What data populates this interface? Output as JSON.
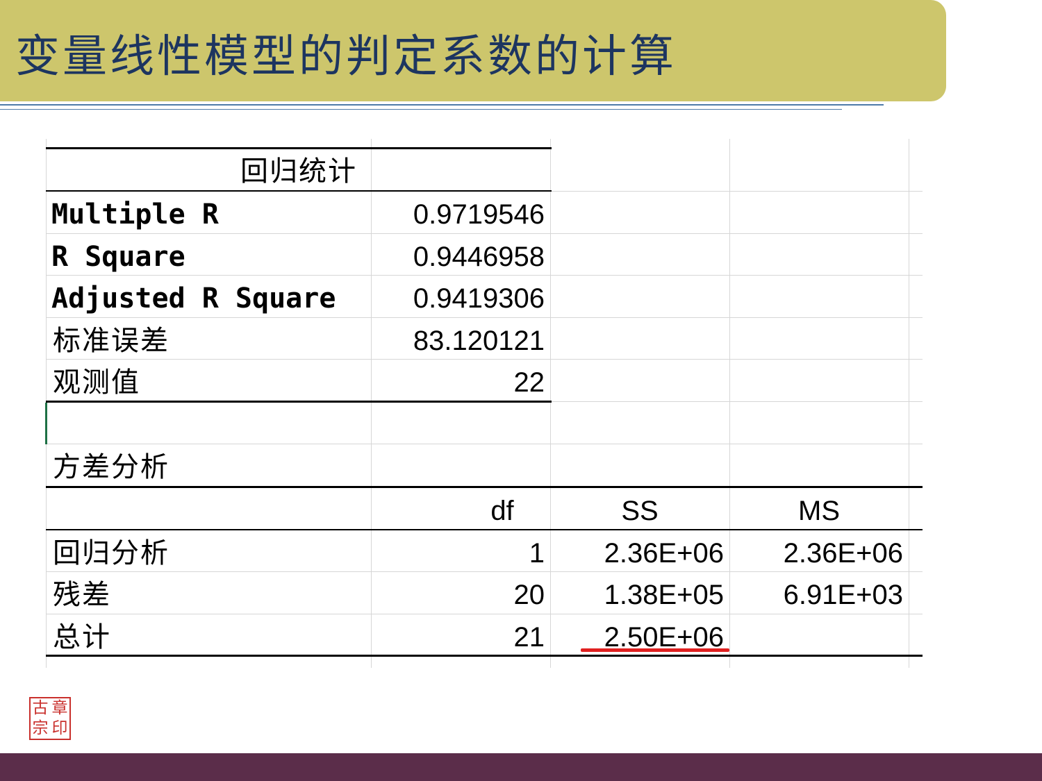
{
  "slide": {
    "title": "变量线性模型的判定系数的计算"
  },
  "regression_stats": {
    "header": "回归统计",
    "rows": [
      {
        "label": "Multiple R",
        "value": "0.9719546"
      },
      {
        "label": "R Square",
        "value": "0.9446958"
      },
      {
        "label": "Adjusted R Square",
        "value": "0.9419306"
      },
      {
        "label": "标准误差",
        "value": "83.120121"
      },
      {
        "label": "观测值",
        "value": "22"
      }
    ]
  },
  "anova": {
    "title": "方差分析",
    "columns": [
      "",
      "df",
      "SS",
      "MS"
    ],
    "rows": [
      {
        "label": "回归分析",
        "df": "1",
        "ss": "2.36E+06",
        "ms": "2.36E+06"
      },
      {
        "label": "残差",
        "df": "20",
        "ss": "1.38E+05",
        "ms": "6.91E+03"
      },
      {
        "label": "总计",
        "df": "21",
        "ss": "2.50E+06",
        "ms": ""
      }
    ]
  },
  "seal": {
    "chars": [
      "章",
      "古",
      "印",
      "宗"
    ]
  },
  "colors": {
    "title_band": "#cdc66c",
    "title_text": "#1d3560",
    "bottom_band": "#5b2d4a",
    "highlight_underline": "#e02020",
    "seal": "#c9302c"
  }
}
